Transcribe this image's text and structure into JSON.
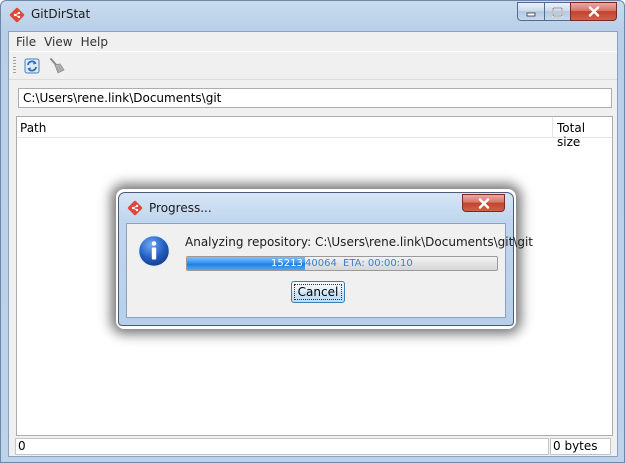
{
  "window": {
    "title": "GitDirStat"
  },
  "menu": {
    "items": [
      "File",
      "View",
      "Help"
    ]
  },
  "toolbar": {
    "buttons": [
      "refresh-icon",
      "broom-icon"
    ]
  },
  "path": {
    "value": "C:\\Users\\rene.link\\Documents\\git"
  },
  "table": {
    "columns": [
      "Path",
      "Total size"
    ]
  },
  "status": {
    "left": "0",
    "right": "0 bytes"
  },
  "dialog": {
    "title": "Progress...",
    "message": "Analyzing repository: C:\\Users\\rene.link\\Documents\\git\\git",
    "progress": {
      "done": "15213",
      "total": "40064",
      "eta": "ETA: 00:00:10",
      "fraction": 0.3797
    },
    "cancel_label": "Cancel"
  },
  "colors": {
    "accent": "#1f7fe0",
    "close_button": "#c2432e",
    "git_logo": "#e2453a"
  }
}
